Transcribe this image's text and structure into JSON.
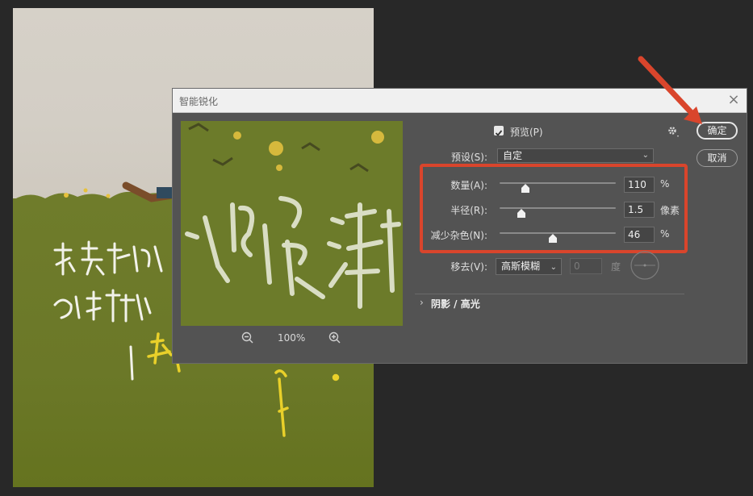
{
  "dialog": {
    "title": "智能锐化",
    "close_icon": "close-icon",
    "preview_checkbox_label": "预览(P)",
    "preview_checked": true,
    "settings_icon": "gear-icon",
    "ok_label": "确定",
    "cancel_label": "取消",
    "preset": {
      "label": "预设(S):",
      "value": "自定"
    },
    "amount": {
      "label": "数量(A):",
      "value": "110",
      "unit": "%",
      "level": 0.22
    },
    "radius": {
      "label": "半径(R):",
      "value": "1.5",
      "unit": "像素",
      "level": 0.19
    },
    "noise": {
      "label": "减少杂色(N):",
      "value": "46",
      "unit": "%",
      "level": 0.46
    },
    "remove": {
      "label": "移去(V):",
      "value": "高斯模糊",
      "angle_value": "0",
      "angle_unit": "度"
    },
    "section_shadow": "阴影 / 高光",
    "zoom": {
      "level": "100%",
      "zoom_out_icon": "zoom-out-icon",
      "zoom_in_icon": "zoom-in-icon"
    }
  },
  "colors": {
    "highlight": "#d9452c",
    "dialog_bg": "#535353",
    "grass": "#6e7a2a",
    "paper": "#d6d1c8",
    "workspace": "#282828"
  }
}
